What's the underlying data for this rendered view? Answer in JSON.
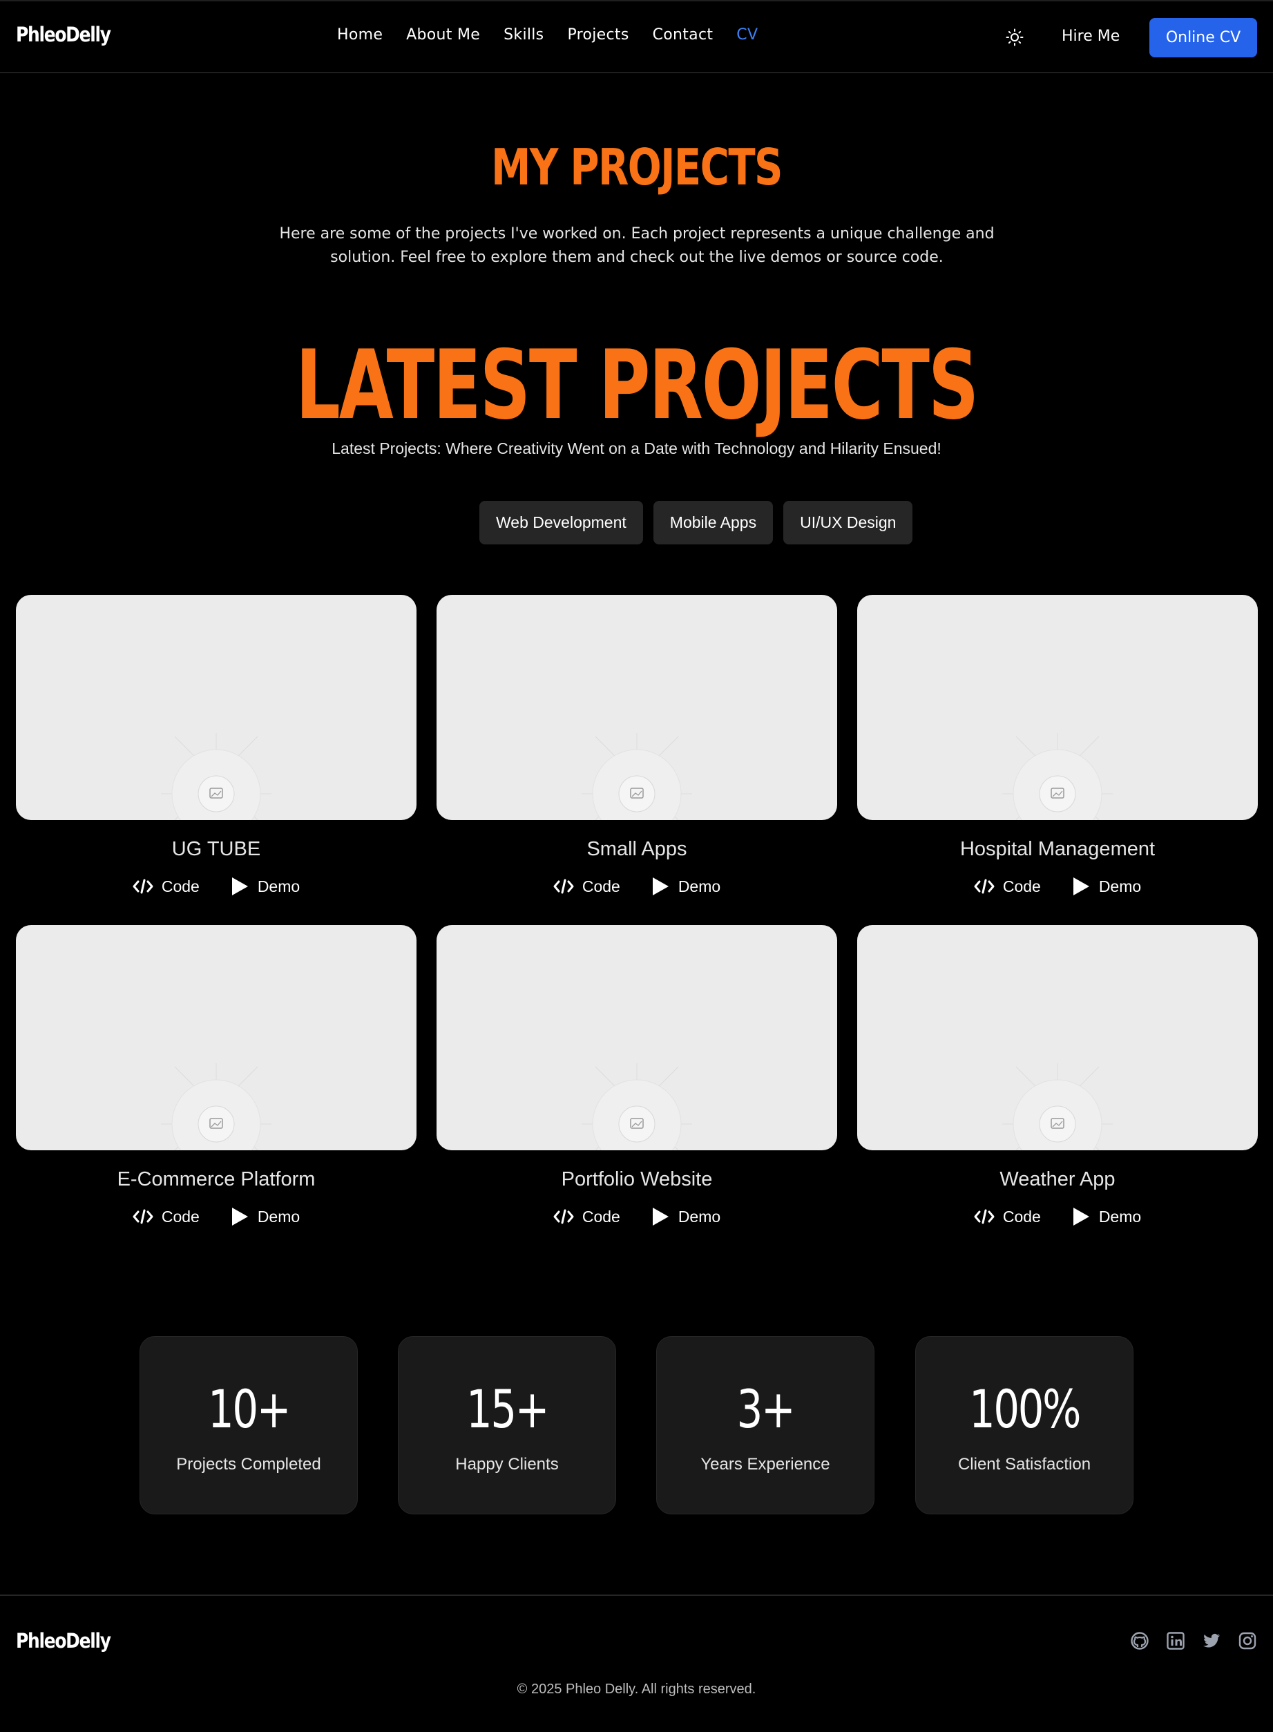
{
  "brand": "PhleoDelly",
  "nav": {
    "links": [
      "Home",
      "About Me",
      "Skills",
      "Projects",
      "Contact",
      "CV"
    ],
    "theme_icon": "sun-icon",
    "hire_label": "Hire Me",
    "cv_label": "Online CV",
    "accent": "#2563eb",
    "active_link_color": "#3b82f6"
  },
  "hero": {
    "title": "MY PROJECTS",
    "intro": "Here are some of the projects I've worked on. Each project represents a unique challenge and solution. Feel free to explore them and check out the live demos or source code.",
    "title_color": "#f97316"
  },
  "latest": {
    "title": "LATEST PROJECTS",
    "tagline": "Latest Projects: Where Creativity Went on a Date with Technology and Hilarity Ensued!"
  },
  "filters": [
    "Web Development",
    "Mobile Apps",
    "UI/UX Design"
  ],
  "projects": [
    {
      "title": "UG TUBE",
      "code_label": "Code",
      "demo_label": "Demo"
    },
    {
      "title": "Small Apps",
      "code_label": "Code",
      "demo_label": "Demo"
    },
    {
      "title": "Hospital Management",
      "code_label": "Code",
      "demo_label": "Demo"
    },
    {
      "title": "E-Commerce Platform",
      "code_label": "Code",
      "demo_label": "Demo"
    },
    {
      "title": "Portfolio Website",
      "code_label": "Code",
      "demo_label": "Demo"
    },
    {
      "title": "Weather App",
      "code_label": "Code",
      "demo_label": "Demo"
    }
  ],
  "stats": [
    {
      "value": "10+",
      "label": "Projects Completed"
    },
    {
      "value": "15+",
      "label": "Happy Clients"
    },
    {
      "value": "3+",
      "label": "Years Experience"
    },
    {
      "value": "100%",
      "label": "Client Satisfaction"
    }
  ],
  "footer": {
    "brand": "PhleoDelly",
    "socials": [
      "github-icon",
      "linkedin-icon",
      "twitter-icon",
      "instagram-icon"
    ],
    "copyright": "© 2025 Phleo Delly. All rights reserved."
  }
}
